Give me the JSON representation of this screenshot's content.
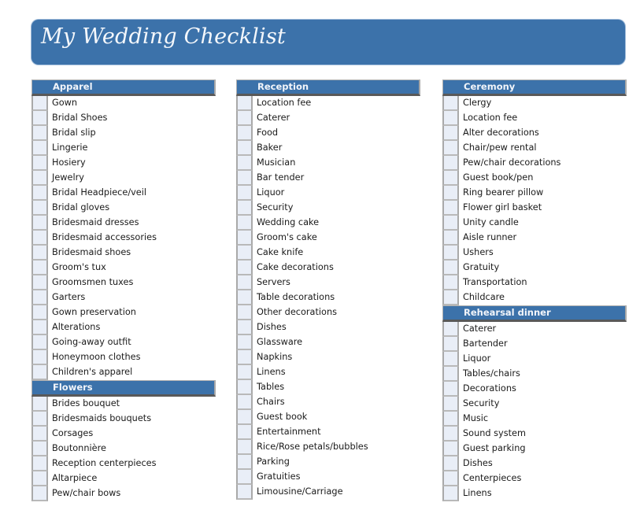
{
  "page": {
    "title": "My Wedding Checklist",
    "colors": {
      "accent": "#3c72aa",
      "checkbox_fill": "#e9eef7",
      "header_text": "#f2f5fa"
    }
  },
  "columns": [
    {
      "sections": [
        {
          "title": "Apparel",
          "items": [
            "Gown",
            "Bridal Shoes",
            "Bridal slip",
            "Lingerie",
            "Hosiery",
            "Jewelry",
            "Bridal Headpiece/veil",
            "Bridal gloves",
            "Bridesmaid dresses",
            "Bridesmaid accessories",
            "Bridesmaid shoes",
            "Groom's tux",
            "Groomsmen tuxes",
            "Garters",
            "Gown preservation",
            "Alterations",
            "Going-away outfit",
            "Honeymoon clothes",
            "Children's apparel"
          ]
        },
        {
          "title": "Flowers",
          "items": [
            "Brides bouquet",
            "Bridesmaids bouquets",
            "Corsages",
            "Boutonnière",
            "Reception centerpieces",
            "Altarpiece",
            "Pew/chair bows"
          ]
        }
      ]
    },
    {
      "sections": [
        {
          "title": "Reception",
          "items": [
            "Location fee",
            "Caterer",
            "Food",
            "Baker",
            "Musician",
            "Bar tender",
            "Liquor",
            "Security",
            "Wedding cake",
            "Groom's cake",
            "Cake knife",
            "Cake decorations",
            "Servers",
            "Table decorations",
            "Other decorations",
            "Dishes",
            "Glassware",
            "Napkins",
            "Linens",
            "Tables",
            "Chairs",
            "Guest book",
            "Entertainment",
            "Rice/Rose petals/bubbles",
            "Parking",
            "Gratuities",
            "Limousine/Carriage"
          ]
        }
      ]
    },
    {
      "sections": [
        {
          "title": "Ceremony",
          "items": [
            "Clergy",
            "Location fee",
            "Alter decorations",
            "Chair/pew rental",
            "Pew/chair decorations",
            "Guest book/pen",
            "Ring bearer pillow",
            "Flower girl basket",
            "Unity candle",
            "Aisle runner",
            "Ushers",
            "Gratuity",
            "Transportation",
            "Childcare"
          ]
        },
        {
          "title": "Rehearsal dinner",
          "items": [
            "Caterer",
            "Bartender",
            "Liquor",
            "Tables/chairs",
            "Decorations",
            "Security",
            "Music",
            "Sound system",
            "Guest parking",
            "Dishes",
            "Centerpieces",
            "Linens"
          ]
        }
      ]
    }
  ]
}
